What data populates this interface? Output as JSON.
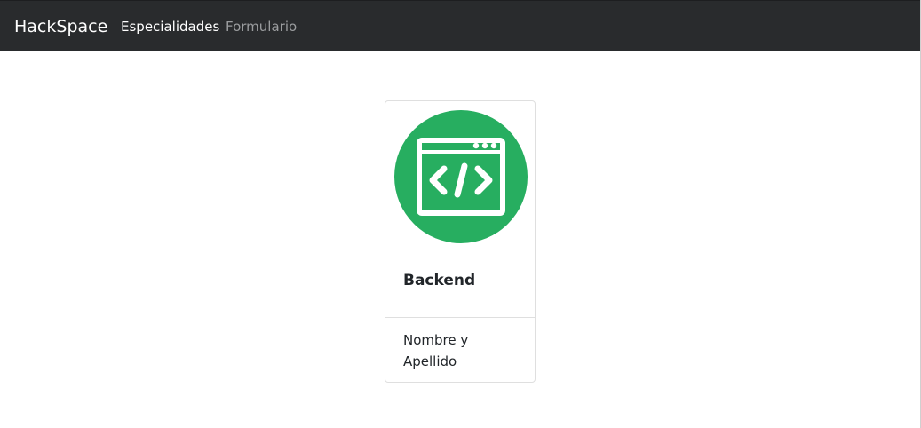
{
  "navbar": {
    "brand": "HackSpace",
    "links": [
      {
        "label": "Especialidades",
        "active": true
      },
      {
        "label": "Formulario",
        "active": false
      }
    ]
  },
  "card": {
    "icon": "code-window-icon",
    "icon_color": "#27ae60",
    "title": "Backend",
    "footer_text": "Nombre y Apellido"
  },
  "colors": {
    "navbar_bg": "#292b2d",
    "accent": "#27ae60"
  }
}
